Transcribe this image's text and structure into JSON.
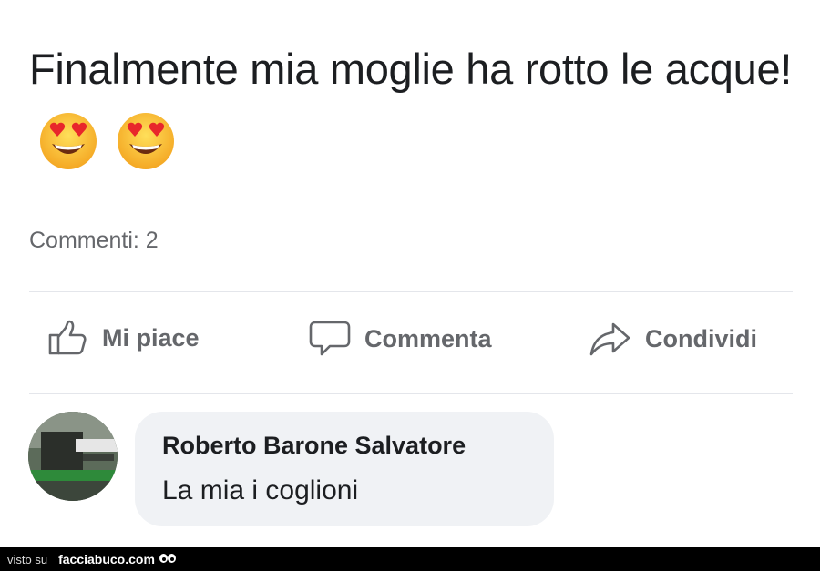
{
  "post": {
    "text": "Finalmente mia moglie ha rotto le acque!",
    "emojis": [
      "heart-eyes-emoji",
      "heart-eyes-emoji"
    ]
  },
  "stats": {
    "comments_label": "Commenti: 2"
  },
  "actions": {
    "like": "Mi piace",
    "comment": "Commenta",
    "share": "Condividi"
  },
  "comment": {
    "author": "Roberto Barone Salvatore",
    "text": "La mia i coglioni"
  },
  "footer": {
    "visto": "visto su",
    "site": "facciabuco.com"
  },
  "colors": {
    "text": "#1c1e21",
    "secondary": "#65676b",
    "bubble": "#f0f2f5",
    "divider": "#e4e6eb"
  }
}
